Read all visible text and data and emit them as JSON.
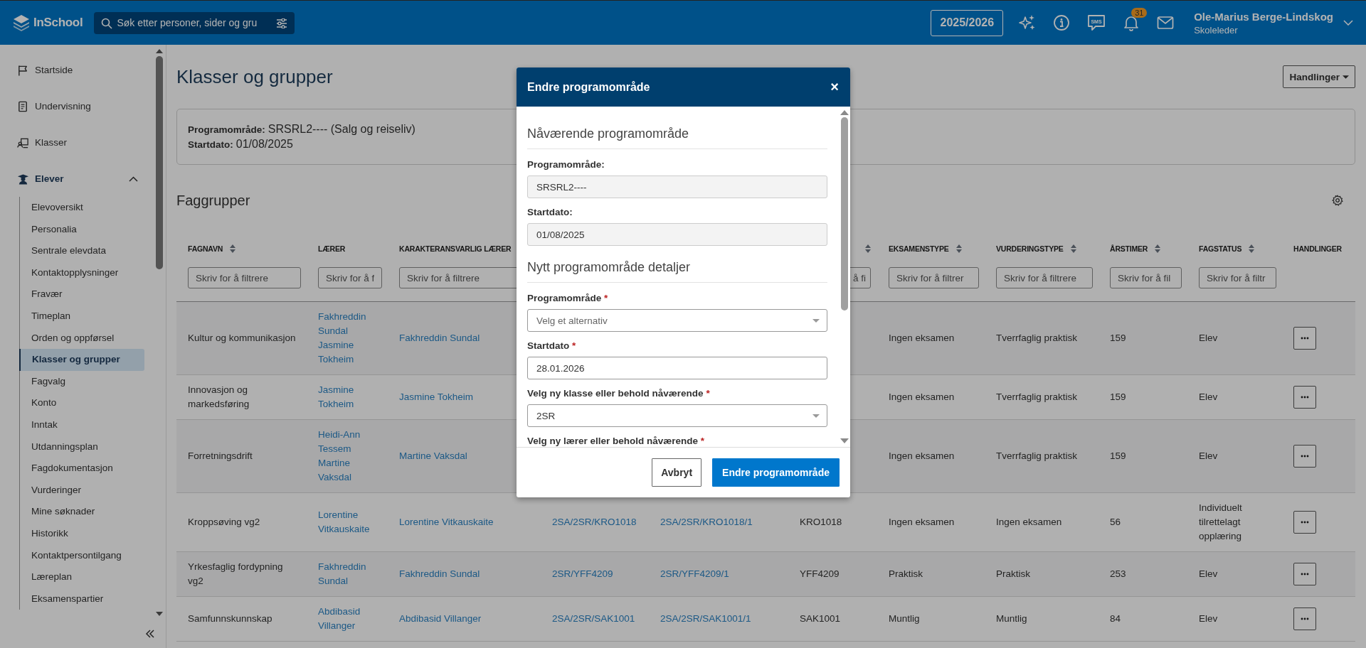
{
  "topbar": {
    "logo_text": "InSchool",
    "search": {
      "placeholder": "Søk etter personer, sider og gru"
    },
    "school_year": "2025/2026",
    "sms_label": "SMS",
    "notification_count": "31",
    "user": {
      "name": "Ole-Marius Berge-Lindskog",
      "role": "Skoleleder"
    }
  },
  "sidebar": {
    "items": [
      {
        "label": "Startside",
        "selected": false
      },
      {
        "label": "Undervisning",
        "selected": false
      },
      {
        "label": "Klasser",
        "selected": false
      },
      {
        "label": "Elever",
        "selected": false,
        "expanded": true,
        "children": [
          {
            "label": "Elevoversikt",
            "selected": false
          },
          {
            "label": "Personalia",
            "selected": false
          },
          {
            "label": "Sentrale elevdata",
            "selected": false
          },
          {
            "label": "Kontaktopplysninger",
            "selected": false
          },
          {
            "label": "Fravær",
            "selected": false
          },
          {
            "label": "Timeplan",
            "selected": false
          },
          {
            "label": "Orden og oppførsel",
            "selected": false
          },
          {
            "label": "Klasser og grupper",
            "selected": true
          },
          {
            "label": "Fagvalg",
            "selected": false
          },
          {
            "label": "Konto",
            "selected": false
          },
          {
            "label": "Inntak",
            "selected": false
          },
          {
            "label": "Utdanningsplan",
            "selected": false
          },
          {
            "label": "Fagdokumentasjon",
            "selected": false
          },
          {
            "label": "Vurderinger",
            "selected": false
          },
          {
            "label": "Mine søknader",
            "selected": false
          },
          {
            "label": "Historikk",
            "selected": false
          },
          {
            "label": "Kontaktpersontilgang",
            "selected": false
          },
          {
            "label": "Læreplan",
            "selected": false
          },
          {
            "label": "Eksamenspartier",
            "selected": false
          }
        ]
      }
    ]
  },
  "page": {
    "title": "Klasser og grupper",
    "actions_button": "Handlinger"
  },
  "info_card": {
    "fields": [
      {
        "label": "Programområde:",
        "value": "SRSRL2---- (Salg og reiseliv)"
      },
      {
        "label": "Startdato:",
        "value": "01/08/2025"
      }
    ]
  },
  "section": {
    "title": "Faggrupper"
  },
  "table": {
    "columns": [
      {
        "label": "FAGNAVN",
        "sortable": true,
        "filter_placeholder": "Skriv for å filtrere"
      },
      {
        "label": "LÆRER",
        "sortable": false,
        "filter_placeholder": "Skriv for å f"
      },
      {
        "label": "KARAKTERANSVARLIG LÆRER",
        "filter_placeholder": "Skriv for å filtrere"
      },
      null,
      null,
      {
        "sortable": true,
        "filter_placeholder": "å fi"
      },
      {
        "label": "EKSAMENSTYPE",
        "sortable": true,
        "filter_placeholder": "Skriv for å filtrer"
      },
      {
        "label": "VURDERINGSTYPE",
        "sortable": true,
        "filter_placeholder": "Skriv for å filtrere"
      },
      {
        "label": "ÅRSTIMER",
        "sortable": true,
        "filter_placeholder": "Skriv for å fil"
      },
      {
        "label": "FAGSTATUS",
        "sortable": true,
        "filter_placeholder": "Skriv for å filtr"
      },
      {
        "label": "HANDLINGER",
        "sortable": false
      }
    ],
    "rows": [
      {
        "cells": [
          {
            "kind": "text",
            "text": "Kultur og kommunikasjon"
          },
          {
            "kind": "links",
            "links": [
              "Fakhreddin Sundal",
              "Jasmine Tokheim"
            ]
          },
          {
            "kind": "links",
            "links": [
              "Fakhreddin Sundal"
            ]
          },
          null,
          null,
          null,
          {
            "kind": "text",
            "text": "Ingen eksamen"
          },
          {
            "kind": "text",
            "text": "Tverrfaglig praktisk"
          },
          {
            "kind": "text",
            "text": "159"
          },
          {
            "kind": "text",
            "text": "Elev"
          },
          {
            "kind": "actions"
          }
        ]
      },
      {
        "cells": [
          {
            "kind": "text",
            "text": "Innovasjon og markedsføring"
          },
          {
            "kind": "links",
            "links": [
              "Jasmine Tokheim"
            ]
          },
          {
            "kind": "links",
            "links": [
              "Jasmine Tokheim"
            ]
          },
          null,
          null,
          null,
          {
            "kind": "text",
            "text": "Ingen eksamen"
          },
          {
            "kind": "text",
            "text": "Tverrfaglig praktisk"
          },
          {
            "kind": "text",
            "text": "159"
          },
          {
            "kind": "text",
            "text": "Elev"
          },
          {
            "kind": "actions"
          }
        ]
      },
      {
        "cells": [
          {
            "kind": "text",
            "text": "Forretningsdrift"
          },
          {
            "kind": "links",
            "links": [
              "Heidi-Ann Tessem",
              "Martine Vaksdal"
            ]
          },
          {
            "kind": "links",
            "links": [
              "Martine Vaksdal"
            ]
          },
          null,
          null,
          null,
          {
            "kind": "text",
            "text": "Ingen eksamen"
          },
          {
            "kind": "text",
            "text": "Tverrfaglig praktisk"
          },
          {
            "kind": "text",
            "text": "159"
          },
          {
            "kind": "text",
            "text": "Elev"
          },
          {
            "kind": "actions"
          }
        ]
      },
      {
        "cells": [
          {
            "kind": "text",
            "text": "Kroppsøving vg2"
          },
          {
            "kind": "links",
            "links": [
              "Lorentine Vitkauskaite"
            ]
          },
          {
            "kind": "links",
            "links": [
              "Lorentine Vitkauskaite"
            ]
          },
          {
            "kind": "links",
            "links": [
              "2SA/2SR/KRO1018"
            ]
          },
          {
            "kind": "links",
            "links": [
              "2SA/2SR/KRO1018/1"
            ]
          },
          {
            "kind": "text",
            "text": "KRO1018"
          },
          {
            "kind": "text",
            "text": "Ingen eksamen"
          },
          {
            "kind": "text",
            "text": "Ingen eksamen"
          },
          {
            "kind": "text",
            "text": "56"
          },
          {
            "kind": "text",
            "text": "Individuelt tilrettelagt opplæring"
          },
          {
            "kind": "actions"
          }
        ]
      },
      {
        "cells": [
          {
            "kind": "text",
            "text": "Yrkesfaglig fordypning vg2"
          },
          {
            "kind": "links",
            "links": [
              "Fakhreddin Sundal"
            ]
          },
          {
            "kind": "links",
            "links": [
              "Fakhreddin Sundal"
            ]
          },
          {
            "kind": "links",
            "links": [
              "2SR/YFF4209"
            ]
          },
          {
            "kind": "links",
            "links": [
              "2SR/YFF4209/1"
            ]
          },
          {
            "kind": "text",
            "text": "YFF4209"
          },
          {
            "kind": "text",
            "text": "Praktisk"
          },
          {
            "kind": "text",
            "text": "Praktisk"
          },
          {
            "kind": "text",
            "text": "253"
          },
          {
            "kind": "text",
            "text": "Elev"
          },
          {
            "kind": "actions"
          }
        ]
      },
      {
        "cells": [
          {
            "kind": "text",
            "text": "Samfunnskunnskap"
          },
          {
            "kind": "links",
            "links": [
              "Abdibasid Villanger"
            ]
          },
          {
            "kind": "links",
            "links": [
              "Abdibasid Villanger"
            ]
          },
          {
            "kind": "links",
            "links": [
              "2SA/2SR/SAK1001"
            ]
          },
          {
            "kind": "links",
            "links": [
              "2SA/2SR/SAK1001/1"
            ]
          },
          {
            "kind": "text",
            "text": "SAK1001"
          },
          {
            "kind": "text",
            "text": "Muntlig"
          },
          {
            "kind": "text",
            "text": "Muntlig"
          },
          {
            "kind": "text",
            "text": "84"
          },
          {
            "kind": "text",
            "text": "Elev"
          },
          {
            "kind": "actions"
          }
        ]
      }
    ]
  },
  "modal": {
    "title": "Endre programområde",
    "close": "×",
    "sections": [
      {
        "heading": "Nåværende programområde",
        "fields": [
          {
            "kind": "readonly",
            "label": "Programområde:",
            "value": "SRSRL2----"
          },
          {
            "kind": "readonly",
            "label": "Startdato:",
            "value": "01/08/2025"
          }
        ]
      },
      {
        "heading": "Nytt programområde detaljer",
        "fields": [
          {
            "kind": "select",
            "label": "Programområde",
            "required_mark": "*",
            "placeholder": "Velg et alternativ"
          },
          {
            "kind": "input",
            "label": "Startdato",
            "required_mark": "*",
            "value": "28.01.2026"
          },
          {
            "kind": "select",
            "label": "Velg ny klasse eller behold nåværende",
            "required_mark": "*",
            "value": "2SR"
          },
          {
            "kind": "label_only",
            "label": "Velg ny lærer eller behold nåværende",
            "required_mark": "*"
          }
        ]
      }
    ],
    "buttons": [
      {
        "kind": "secondary",
        "label": "Avbryt"
      },
      {
        "kind": "primary",
        "label": "Endre programområde"
      }
    ]
  }
}
